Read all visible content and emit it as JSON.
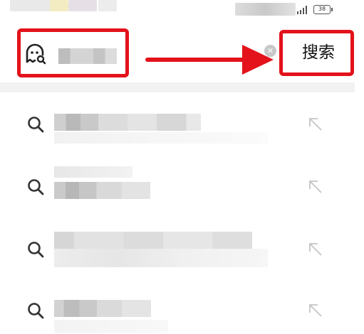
{
  "status_bar": {
    "battery": "38"
  },
  "search": {
    "button_label": "搜索",
    "clear_icon": "clear-circle-icon",
    "left_icon": "ghost-search-icon"
  },
  "annotations": {
    "color": "#e3121b"
  },
  "suggestions": [
    {
      "icon": "search-icon",
      "action_icon": "fill-arrow-icon"
    },
    {
      "icon": "search-icon",
      "action_icon": "fill-arrow-icon"
    },
    {
      "icon": "search-icon",
      "action_icon": "fill-arrow-icon"
    },
    {
      "icon": "search-icon",
      "action_icon": "fill-arrow-icon"
    }
  ]
}
